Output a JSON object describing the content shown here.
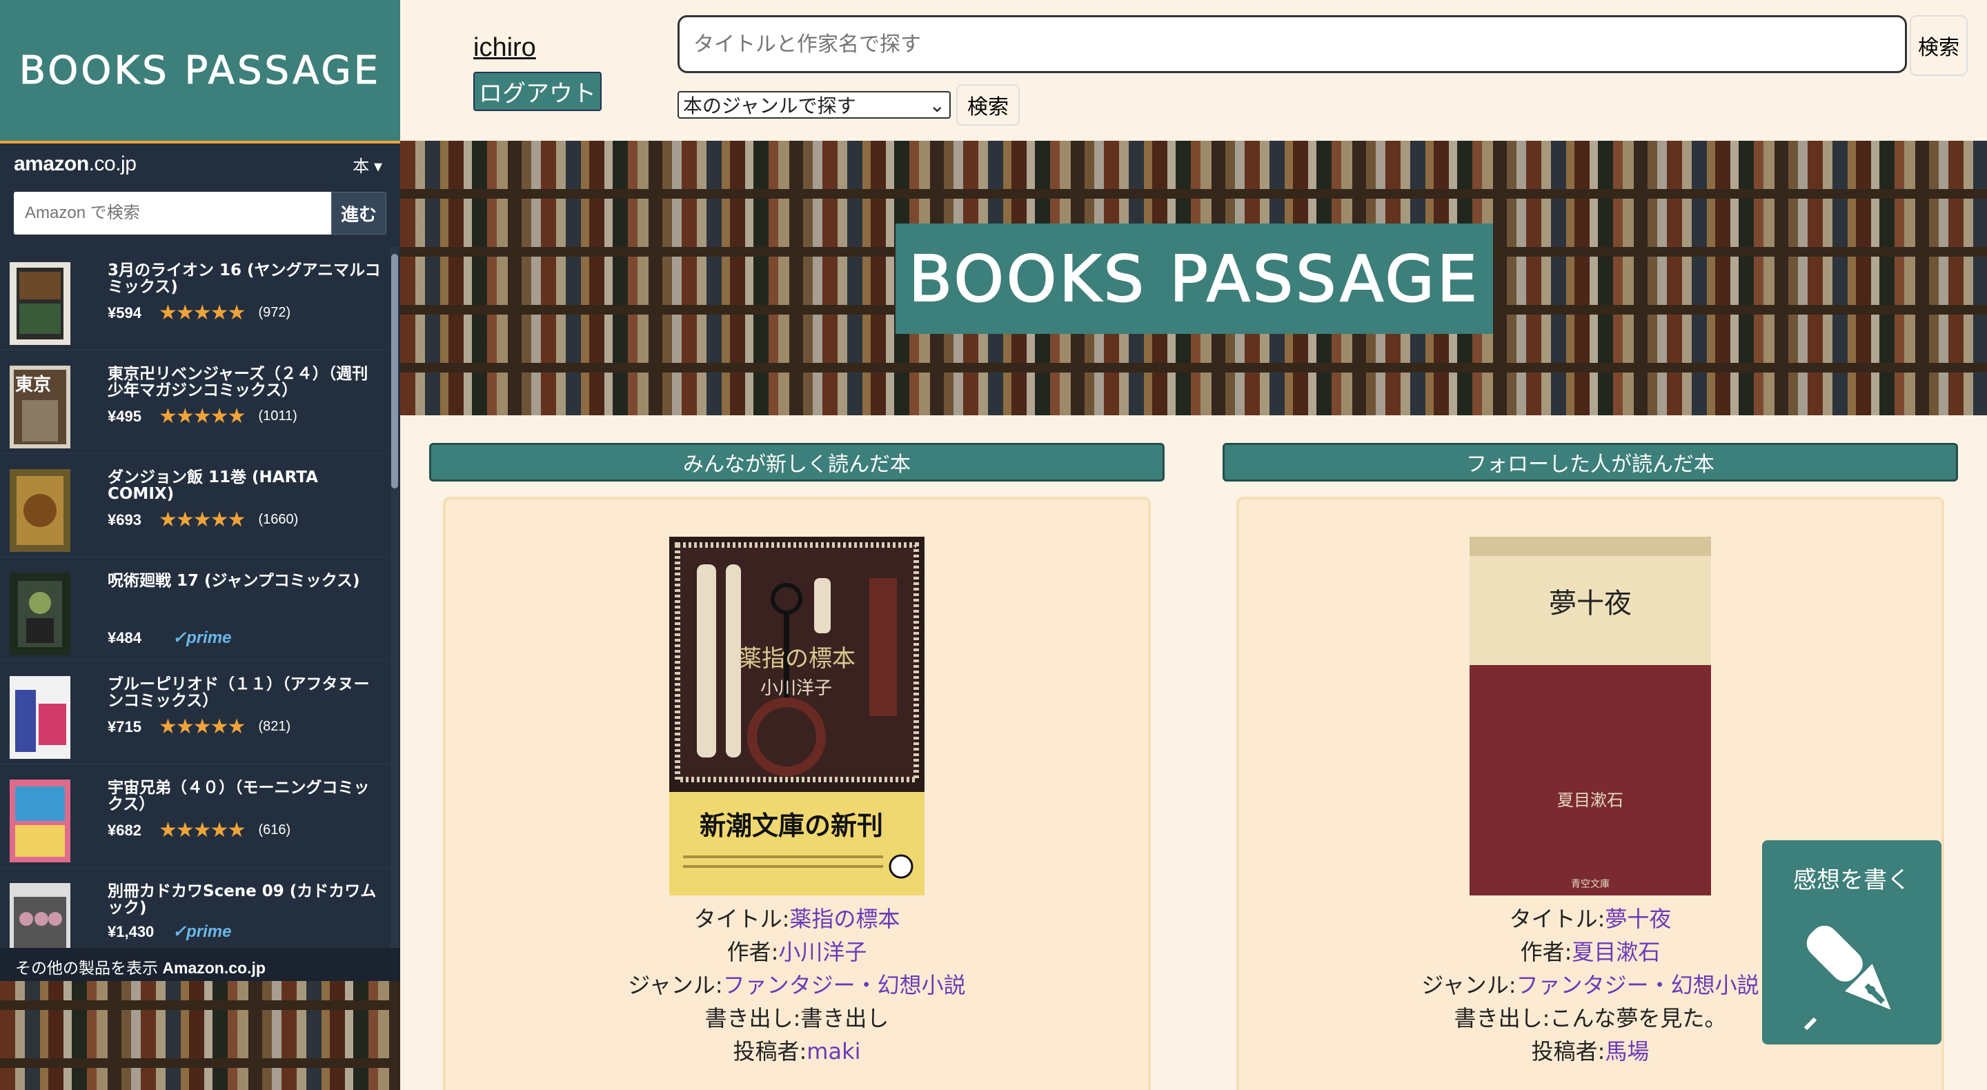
{
  "brand": {
    "title": "BOOKS PASSAGE"
  },
  "header": {
    "username": "ichiro",
    "logout_label": "ログアウト",
    "search_placeholder": "タイトルと作家名で探す",
    "search_button": "検索",
    "genre_select_value": "本のジャンルで探す",
    "genre_search_button": "検索"
  },
  "hero": {
    "title": "BOOKS PASSAGE"
  },
  "amazon": {
    "logo_main": "amazon",
    "logo_tld": ".co.jp",
    "category": "本",
    "search_placeholder": "Amazon で検索",
    "go_label": "進む",
    "footer_prefix": "その他の製品を表示 ",
    "footer_brand": "Amazon.co.jp",
    "items": [
      {
        "title": "3月のライオン 16 (ヤングアニマルコミックス)",
        "price": "¥594",
        "stars": "★★★★★",
        "count": "(972)",
        "prime": ""
      },
      {
        "title": "東京卍リベンジャーズ（２４）（週刊少年マガジンコミックス）",
        "price": "¥495",
        "stars": "★★★★★",
        "count": "(1011)",
        "prime": ""
      },
      {
        "title": "ダンジョン飯 11巻 (HARTA COMIX)",
        "price": "¥693",
        "stars": "★★★★★",
        "count": "(1660)",
        "prime": ""
      },
      {
        "title": "呪術廻戦 17 (ジャンプコミックス)",
        "price": "¥484",
        "stars": "",
        "count": "",
        "prime": "✓prime"
      },
      {
        "title": "ブルーピリオド（１１）（アフタヌーンコミックス）",
        "price": "¥715",
        "stars": "★★★★★",
        "count": "(821)",
        "prime": ""
      },
      {
        "title": "宇宙兄弟（４０）（モーニングコミックス）",
        "price": "¥682",
        "stars": "★★★★★",
        "count": "(616)",
        "prime": ""
      },
      {
        "title": "別冊カドカワScene 09 (カドカワムック)",
        "price": "¥1,430",
        "stars": "",
        "count": "",
        "prime": "✓prime"
      }
    ]
  },
  "columns": {
    "left": {
      "header": "みんなが新しく読んだ本",
      "cover_title": "薬指の標本",
      "cover_author": "小川洋子",
      "cover_band": "新潮文庫の新刊",
      "title_label": "タイトル:",
      "title": "薬指の標本",
      "author_label": "作者:",
      "author": "小川洋子",
      "genre_label": "ジャンル:",
      "genre": "ファンタジー・幻想小説",
      "opening_label": "書き出し:",
      "opening": "書き出し",
      "poster_label": "投稿者:",
      "poster": "maki"
    },
    "right": {
      "header": "フォローした人が読んだ本",
      "cover_title": "夢十夜",
      "cover_author": "夏目漱石",
      "cover_publisher": "青空文庫",
      "title_label": "タイトル:",
      "title": "夢十夜",
      "author_label": "作者:",
      "author": "夏目漱石",
      "genre_label": "ジャンル:",
      "genre": "ファンタジー・幻想小説",
      "opening_label": "書き出し:",
      "opening": "こんな夢を見た。",
      "poster_label": "投稿者:",
      "poster": "馬場"
    }
  },
  "fab": {
    "label": "感想を書く"
  },
  "colors": {
    "teal": "#3d7f7a",
    "cream": "#fcf3e6",
    "card": "#fcebd2",
    "link": "#6c3ab8",
    "amazon_bg": "#232f3e"
  }
}
